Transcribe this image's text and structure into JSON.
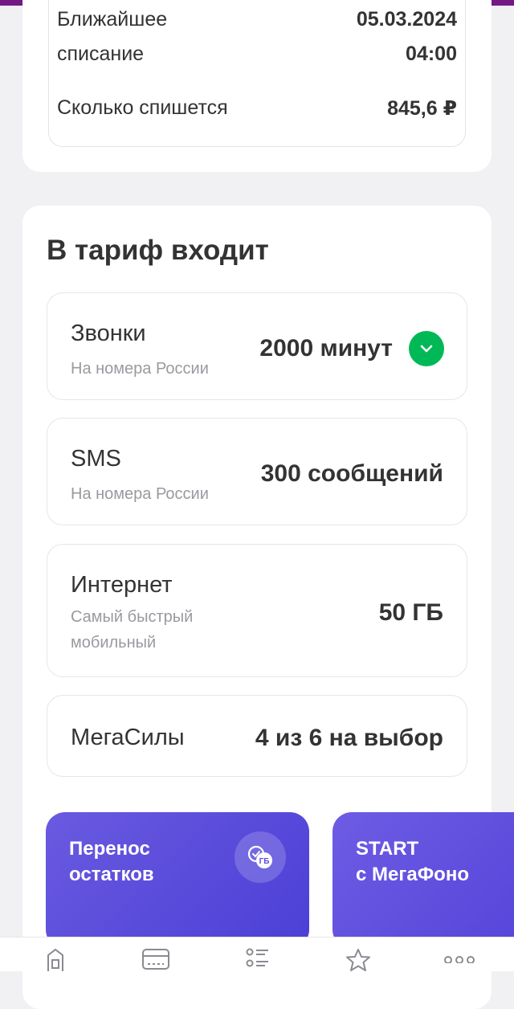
{
  "payment": {
    "next_charge_label": "Ближайшее\nсписание",
    "next_charge_value": "05.03.2024\n04:00",
    "amount_label": "Сколько спишется",
    "amount_value": "845,6 ₽"
  },
  "tariff": {
    "title": "В тариф входит",
    "features": [
      {
        "name": "Звонки",
        "sub": "На номера России",
        "value": "2000 минут"
      },
      {
        "name": "SMS",
        "sub": "На номера России",
        "value": "300 сообщений"
      },
      {
        "name": "Интернет",
        "sub": "Самый быстрый мобильный",
        "value": "50 ГБ"
      },
      {
        "name": "МегаСилы",
        "sub": "",
        "value": "4 из 6 на выбор"
      }
    ]
  },
  "promos": [
    {
      "title": "Перенос\nостатков",
      "icon": "gb-transfer-icon"
    },
    {
      "title": "START\nс МегаФоно",
      "icon": ""
    }
  ],
  "nav": [
    "home-icon",
    "payments-icon",
    "services-icon",
    "favorites-icon",
    "more-icon"
  ],
  "colors": {
    "accent": "#00b956",
    "brand_purple": "#731982",
    "promo": "#5b4bdc"
  }
}
